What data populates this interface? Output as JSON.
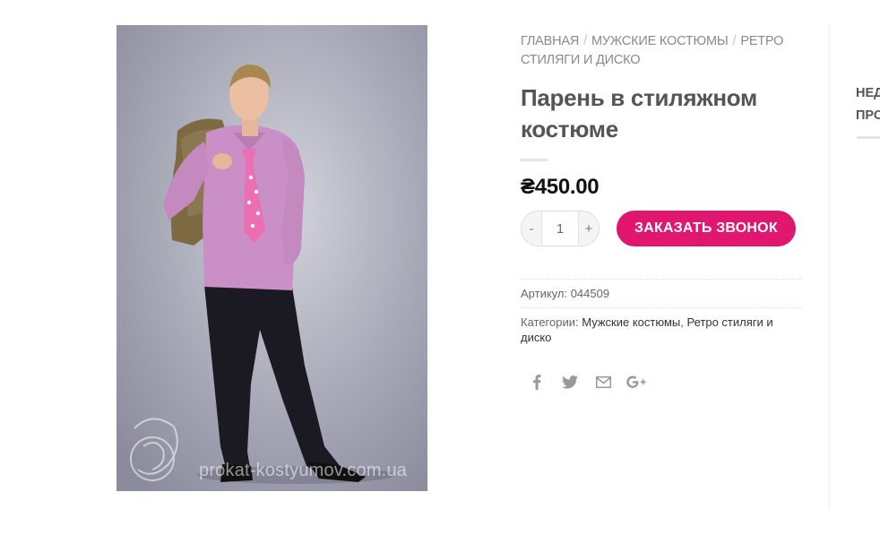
{
  "breadcrumb": {
    "items": [
      "Главная",
      "Мужские костюмы",
      "Ретро стиляги и диско"
    ],
    "separator": "/"
  },
  "product": {
    "title": "Парень в стиляжном костюме",
    "currency_symbol": "₴",
    "price": "450.00",
    "image_watermark": "prokat-kostyumov.com.ua"
  },
  "cart": {
    "minus_label": "-",
    "quantity": "1",
    "plus_label": "+",
    "order_button_label": "ЗАКАЗАТЬ ЗВОНОК"
  },
  "meta": {
    "sku_label": "Артикул:",
    "sku_value": "044509",
    "categories_label": "Категории:",
    "categories": [
      "Мужские костюмы",
      "Ретро стиляги и диско"
    ],
    "categories_separator": ", "
  },
  "share": {
    "icons": [
      "facebook-icon",
      "twitter-icon",
      "email-icon",
      "google-plus-icon"
    ]
  },
  "sidebar": {
    "title_line1": "НЕД",
    "title_line2": "ПРО"
  },
  "colors": {
    "accent": "#e0166f",
    "text_dark": "#555555",
    "text_muted": "#8a8a8a"
  }
}
